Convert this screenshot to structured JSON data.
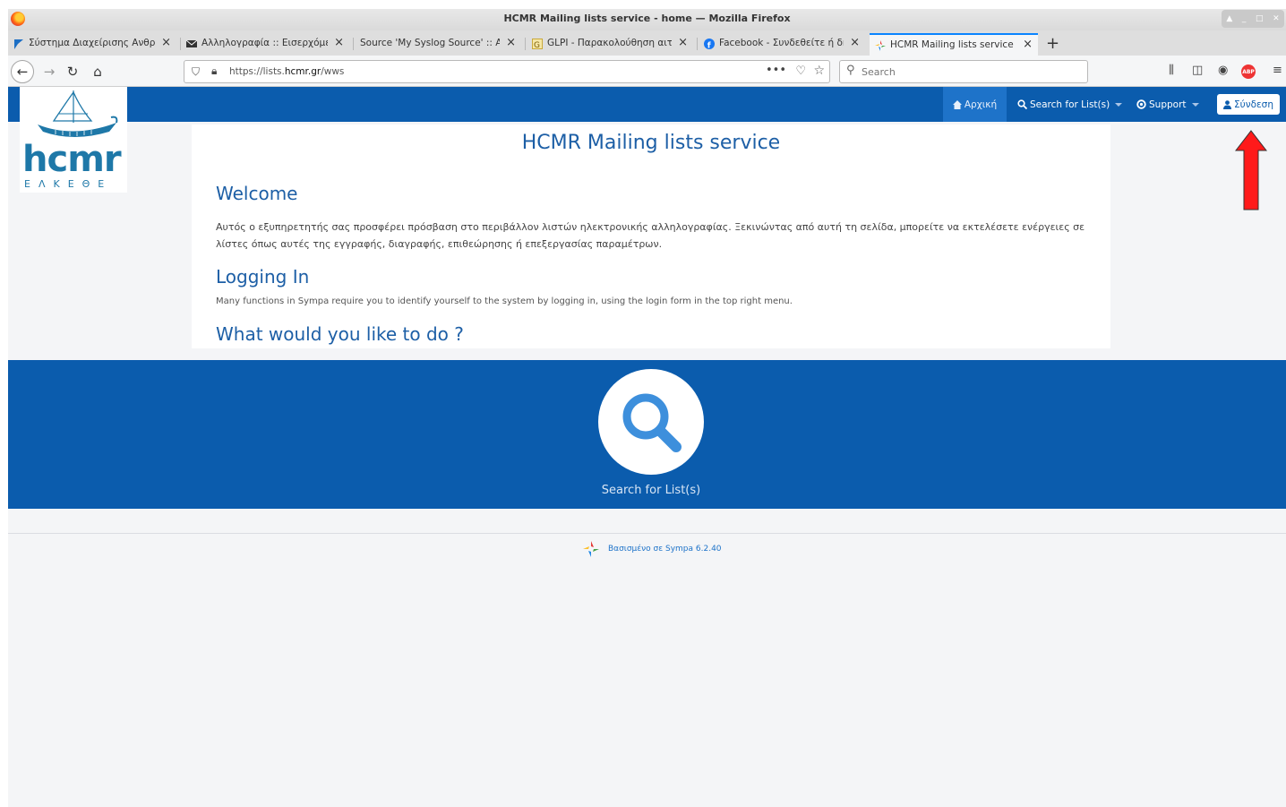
{
  "window": {
    "title": "HCMR Mailing lists service - home — Mozilla Firefox"
  },
  "tabs": [
    {
      "label": "Σύστημα Διαχείρισης Ανθρώ",
      "icon": "blue-flag-icon"
    },
    {
      "label": "Αλληλογραφία :: Εισερχόμενα",
      "icon": "envelope-icon"
    },
    {
      "label": "Source 'My Syslog Source' :: Admin",
      "icon": "none"
    },
    {
      "label": "GLPI - Παρακολούθηση αιτήματος",
      "icon": "glpi-icon"
    },
    {
      "label": "Facebook - Συνδεθείτε ή δημιουργήστε",
      "icon": "facebook-icon"
    },
    {
      "label": "HCMR Mailing lists service - home",
      "icon": "sympa-icon",
      "active": true
    }
  ],
  "navigation": {
    "url_prefix": "https://lists.",
    "url_domain": "hcmr.gr",
    "url_path": "/wws",
    "search_placeholder": "Search"
  },
  "site_nav": {
    "home": "Αρχική",
    "search": "Search for List(s)",
    "support": "Support",
    "login": "Σύνδεση"
  },
  "logo": {
    "word": "hcmr",
    "sub": "ΕΛΚΕΘΕ"
  },
  "content": {
    "title": "HCMR Mailing lists service",
    "welcome_heading": "Welcome",
    "welcome_text": "Αυτός ο εξυπηρετητής σας προσφέρει πρόσβαση στο περιβάλλον λιστών ηλεκτρονικής αλληλογραφίας. Ξεκινώντας από αυτή τη σελίδα, μπορείτε να εκτελέσετε ενέργειες σε λίστες όπως αυτές της εγγραφής, διαγραφής, επιθεώρησης ή επεξεργασίας παραμέτρων.",
    "login_heading": "Logging In",
    "login_text": "Many functions in Sympa require you to identify yourself to the system by logging in, using the login form in the top right menu.",
    "todo_heading": "What would you like to do ?"
  },
  "band": {
    "search_label": "Search for List(s)"
  },
  "footer": {
    "text_prefix": "Βασισμένο σε",
    "text_link": "Sympa 6.2.40"
  },
  "colors": {
    "brand_blue": "#0b5cad",
    "accent_red": "#ff0000"
  }
}
